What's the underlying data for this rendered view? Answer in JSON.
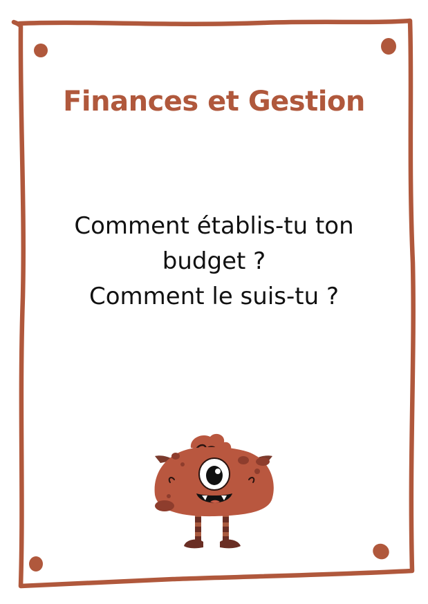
{
  "card": {
    "title": "Finances et Gestion",
    "question_lines": [
      "Comment établis-tu ton",
      "budget ?",
      "Comment le suis-tu ?"
    ]
  },
  "colors": {
    "accent": "#b0583c",
    "text": "#111111",
    "background": "#ffffff"
  },
  "icons": {
    "mascot": "one-eyed-monster-illustration",
    "corner_pins": "rust-dot-pins"
  }
}
